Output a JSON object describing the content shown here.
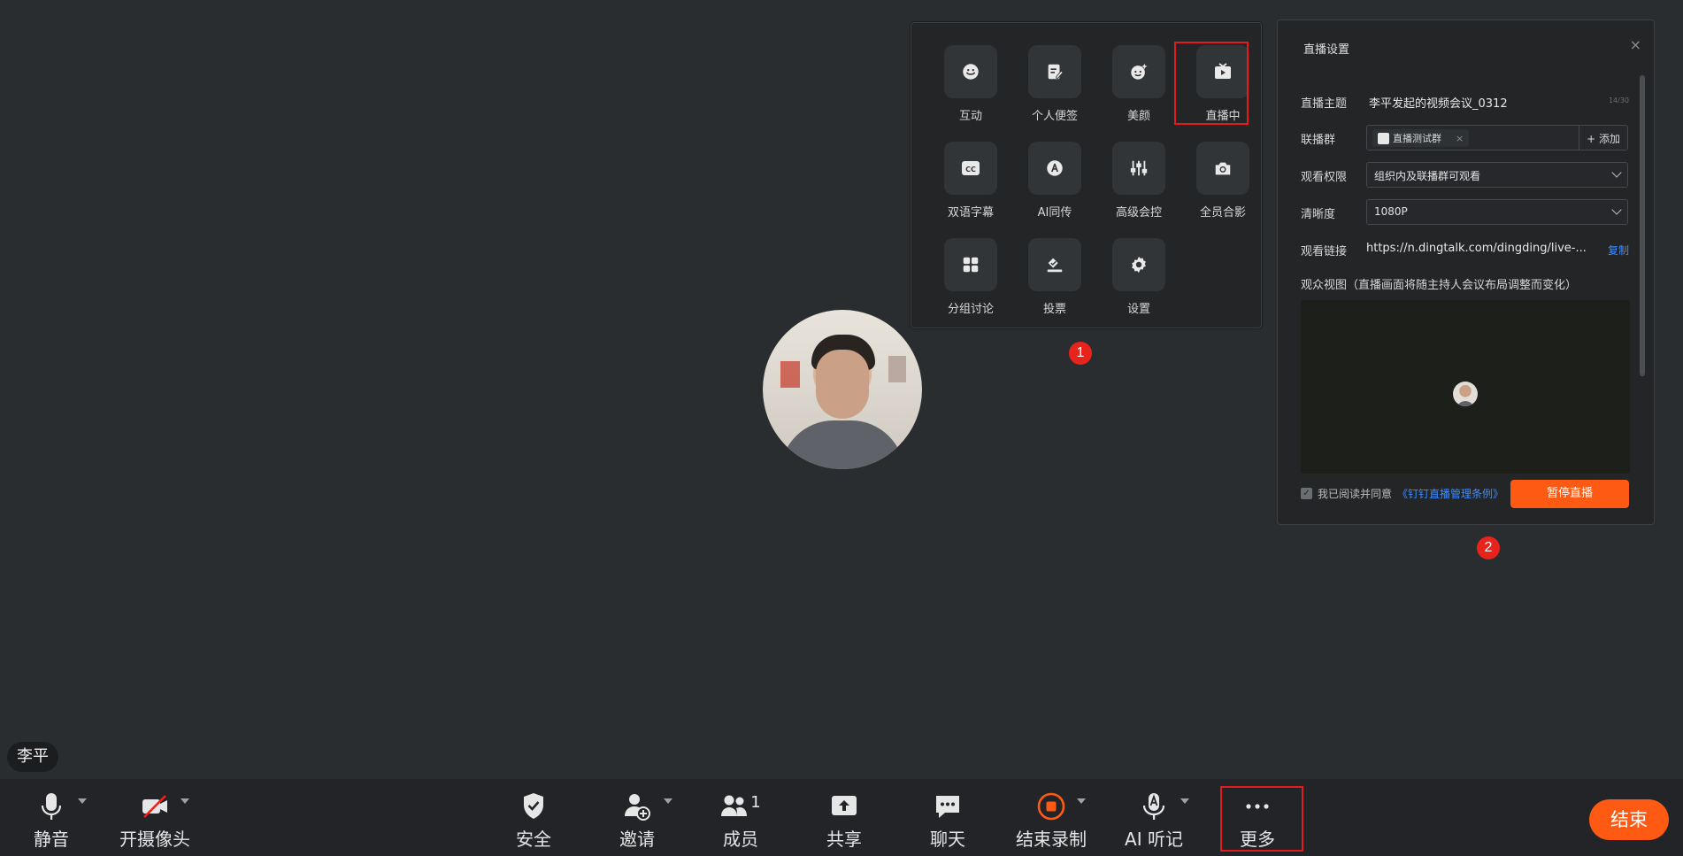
{
  "participant": {
    "name": "李平"
  },
  "more_panel": {
    "tools": [
      {
        "label": "互动",
        "icon": "smile-icon"
      },
      {
        "label": "个人便签",
        "icon": "note-edit-icon"
      },
      {
        "label": "美颜",
        "icon": "beauty-icon"
      },
      {
        "label": "直播中",
        "icon": "live-tv-icon"
      },
      {
        "label": "双语字幕",
        "icon": "cc-icon"
      },
      {
        "label": "AI同传",
        "icon": "ai-translate-icon"
      },
      {
        "label": "高级会控",
        "icon": "sliders-icon"
      },
      {
        "label": "全员合影",
        "icon": "camera-icon"
      },
      {
        "label": "分组讨论",
        "icon": "grid-icon"
      },
      {
        "label": "投票",
        "icon": "vote-icon"
      },
      {
        "label": "设置",
        "icon": "gear-icon"
      }
    ],
    "marker": "1"
  },
  "live_settings": {
    "title": "直播设置",
    "close": "×",
    "topic_label": "直播主题",
    "topic_value": "李平发起的视频会议_0312",
    "topic_counter": "14/30",
    "group_label": "联播群",
    "group_chip": "直播测试群",
    "group_chip_remove": "×",
    "add_label": "+ 添加",
    "permission_label": "观看权限",
    "permission_value": "组织内及联播群可观看",
    "quality_label": "清晰度",
    "quality_value": "1080P",
    "link_label": "观看链接",
    "link_value": "https://n.dingtalk.com/dingding/live-...",
    "copy_label": "复制",
    "view_label": "观众视图（直播画面将随主持人会议布局调整而变化）",
    "agree_text": "我已阅读并同意",
    "agree_link": "《钉钉直播管理条例》",
    "pause_button": "暂停直播",
    "marker": "2"
  },
  "toolbar": {
    "mute": "静音",
    "camera": "开摄像头",
    "security": "安全",
    "invite": "邀请",
    "members": "成员",
    "members_count": "1",
    "share": "共享",
    "chat": "聊天",
    "stop_record": "结束录制",
    "ai_listen": "AI 听记",
    "more": "更多",
    "end": "结束"
  },
  "colors": {
    "accent": "#ff5a14",
    "highlight": "#e21c1c",
    "link": "#3d8cff",
    "background": "#2a2d30"
  }
}
